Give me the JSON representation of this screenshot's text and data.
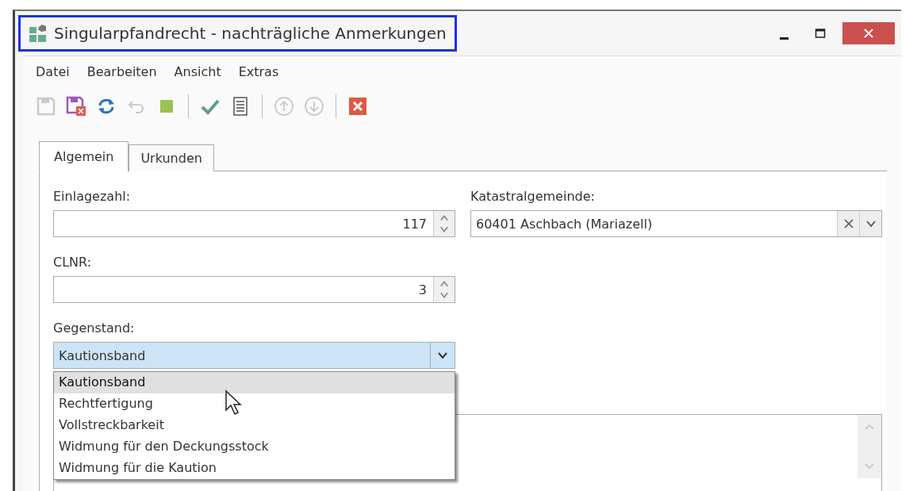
{
  "window": {
    "title": "Singularpfandrecht - nachträgliche Anmerkungen",
    "highlighted": true
  },
  "menu": [
    "Datei",
    "Bearbeiten",
    "Ansicht",
    "Extras"
  ],
  "toolbar": [
    {
      "kind": "save",
      "disabled": true
    },
    {
      "kind": "discard",
      "disabled": false
    },
    {
      "kind": "refresh",
      "disabled": false
    },
    {
      "kind": "undo",
      "disabled": true
    },
    {
      "kind": "stop",
      "disabled": false
    },
    {
      "kind": "separator"
    },
    {
      "kind": "check",
      "disabled": false
    },
    {
      "kind": "document",
      "disabled": false
    },
    {
      "kind": "separator"
    },
    {
      "kind": "up",
      "disabled": true
    },
    {
      "kind": "down",
      "disabled": true
    },
    {
      "kind": "separator"
    },
    {
      "kind": "close",
      "disabled": false
    }
  ],
  "tabs": [
    {
      "label": "Algemein",
      "selected": true
    },
    {
      "label": "Urkunden",
      "selected": false
    }
  ],
  "fields": {
    "einlagezahl": {
      "label": "Einlagezahl:",
      "value": "117"
    },
    "katastralgemeinde": {
      "label": "Katastralgemeinde:",
      "value": "60401 Aschbach (Mariazell)"
    },
    "clnr": {
      "label": "CLNR:",
      "value": "3"
    },
    "gegenstand": {
      "label": "Gegenstand:",
      "value": "Kautionsband",
      "open": true,
      "options": [
        {
          "label": "Kautionsband",
          "selected": true
        },
        {
          "label": "Rechtfertigung",
          "selected": false
        },
        {
          "label": "Vollstreckbarkeit",
          "selected": false
        },
        {
          "label": "Widmung für den Deckungsstock",
          "selected": false
        },
        {
          "label": "Widmung für die Kaution",
          "selected": false
        }
      ]
    }
  }
}
